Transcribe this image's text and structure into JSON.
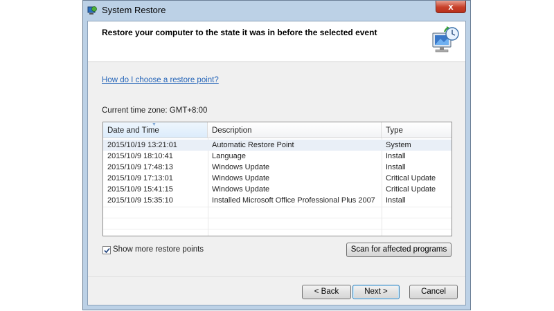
{
  "window": {
    "title": "System Restore",
    "close_label": "x"
  },
  "header": {
    "heading": "Restore your computer to the state it was in before the selected event"
  },
  "help_link": "How do I choose a restore point?",
  "timezone_label": "Current time zone: GMT+8:00",
  "table": {
    "columns": [
      "Date and Time",
      "Description",
      "Type"
    ],
    "sorted_column": "Date and Time",
    "rows": [
      {
        "date": "2015/10/19 13:21:01",
        "description": "Automatic Restore Point",
        "type": "System"
      },
      {
        "date": "2015/10/9 18:10:41",
        "description": "Language",
        "type": "Install"
      },
      {
        "date": "2015/10/9 17:48:13",
        "description": "Windows Update",
        "type": "Install"
      },
      {
        "date": "2015/10/9 17:13:01",
        "description": "Windows Update",
        "type": "Critical Update"
      },
      {
        "date": "2015/10/9 15:41:15",
        "description": "Windows Update",
        "type": "Critical Update"
      },
      {
        "date": "2015/10/9 15:35:10",
        "description": "Installed Microsoft Office Professional Plus 2007",
        "type": "Install"
      }
    ]
  },
  "options": {
    "show_more_label": "Show more restore points",
    "show_more_checked": true
  },
  "buttons": {
    "scan": "Scan for affected programs",
    "back": "< Back",
    "next": "Next >",
    "cancel": "Cancel"
  },
  "icons": {
    "app": "system-restore-icon",
    "header": "restore-computer-icon",
    "close": "close-icon",
    "check": "checkmark-icon"
  },
  "colors": {
    "link": "#2464b8",
    "frame": "#bcd1e6",
    "close_button": "#c7402a",
    "default_button_border": "#3c7fb1"
  }
}
